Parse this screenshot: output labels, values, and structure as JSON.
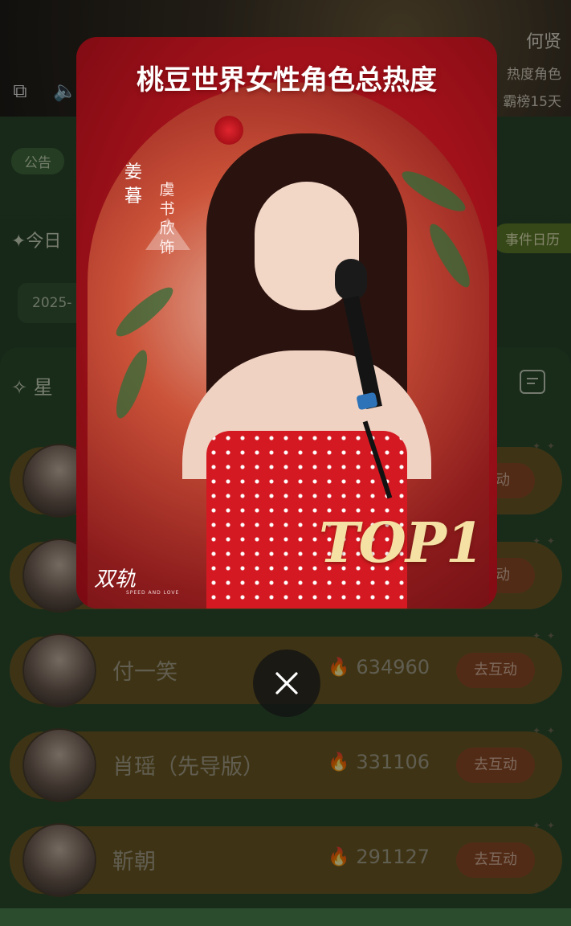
{
  "hero": {
    "name": "何贤",
    "rank_line1": "热度角色",
    "rank_line2": "霸榜15天"
  },
  "notice_label": "公告",
  "today_label": "✦今日",
  "calendar_label": "事件日历",
  "date_text": "2025-",
  "star_title": "星",
  "characters": [
    {
      "name": "",
      "heat": "",
      "action": "互动"
    },
    {
      "name": "",
      "heat": "",
      "action": "互动"
    },
    {
      "name": "付一笑",
      "heat": "634960",
      "action": "去互动"
    },
    {
      "name": "肖瑶（先导版）",
      "heat": "331106",
      "action": "去互动"
    },
    {
      "name": "靳朝",
      "heat": "291127",
      "action": "去互动"
    }
  ],
  "poster": {
    "title": "桃豆世界女性角色总热度",
    "role_name": "姜暮",
    "actor_credit": "虞书欣饰",
    "rank": "TOP1",
    "logo": "双轨",
    "logo_sub": "SPEED AND LOVE"
  },
  "icons": {
    "close": "close-icon",
    "comment": "comment-icon",
    "flame": "flame-icon"
  }
}
